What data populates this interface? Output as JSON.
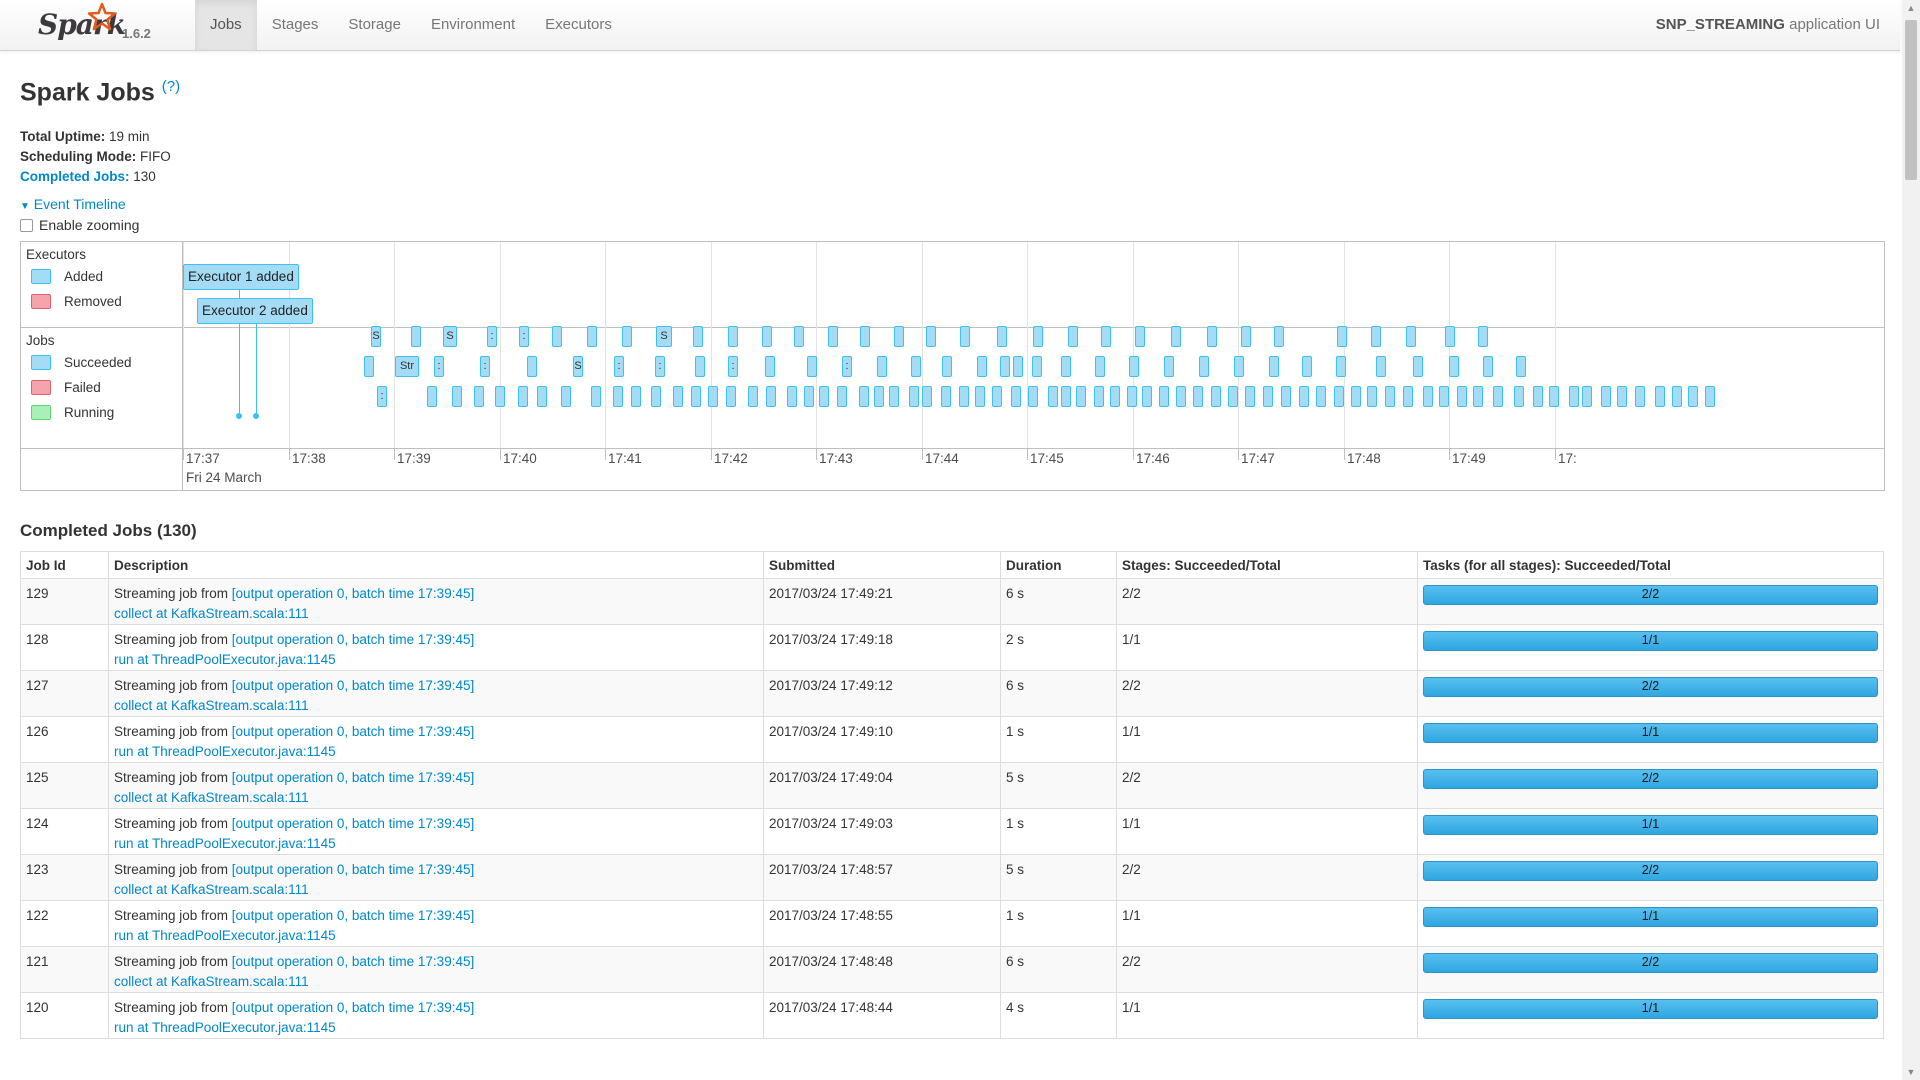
{
  "navbar": {
    "brand": "Spark",
    "version": "1.6.2",
    "tabs": [
      {
        "label": "Jobs",
        "active": true
      },
      {
        "label": "Stages",
        "active": false
      },
      {
        "label": "Storage",
        "active": false
      },
      {
        "label": "Environment",
        "active": false
      },
      {
        "label": "Executors",
        "active": false
      }
    ],
    "app_name": "SNP_STREAMING",
    "app_suffix": "application UI"
  },
  "page": {
    "title": "Spark Jobs",
    "help": "(?)",
    "uptime_label": "Total Uptime:",
    "uptime_value": "19 min",
    "mode_label": "Scheduling Mode:",
    "mode_value": "FIFO",
    "completed_label": "Completed Jobs:",
    "completed_value": "130",
    "timeline_toggle": "Event Timeline",
    "zoom_label": "Enable zooming"
  },
  "timeline": {
    "executors_title": "Executors",
    "legend_added": "Added",
    "legend_removed": "Removed",
    "jobs_title": "Jobs",
    "legend_succeeded": "Succeeded",
    "legend_failed": "Failed",
    "legend_running": "Running",
    "executor1": "Executor 1 added",
    "executor2": "Executor 2 added",
    "axis_labels": [
      "17:37",
      "17:38",
      "17:39",
      "17:40",
      "17:41",
      "17:42",
      "17:43",
      "17:44",
      "17:45",
      "17:46",
      "17:47",
      "17:48",
      "17:49",
      "17:"
    ],
    "date_label": "Fri 24 March"
  },
  "completed": {
    "title": "Completed Jobs (130)",
    "headers": [
      "Job Id",
      "Description",
      "Submitted",
      "Duration",
      "Stages: Succeeded/Total",
      "Tasks (for all stages): Succeeded/Total"
    ],
    "desc_prefix": "Streaming job from ",
    "desc_link": "[output operation 0, batch time 17:39:45]",
    "rows": [
      {
        "id": "129",
        "callsite": "collect at KafkaStream.scala:111",
        "submitted": "2017/03/24 17:49:21",
        "duration": "6 s",
        "stages": "2/2",
        "tasks": "2/2",
        "task_progress": 1.0
      },
      {
        "id": "128",
        "callsite": "run at ThreadPoolExecutor.java:1145",
        "submitted": "2017/03/24 17:49:18",
        "duration": "2 s",
        "stages": "1/1",
        "tasks": "1/1",
        "task_progress": 1.0
      },
      {
        "id": "127",
        "callsite": "collect at KafkaStream.scala:111",
        "submitted": "2017/03/24 17:49:12",
        "duration": "6 s",
        "stages": "2/2",
        "tasks": "2/2",
        "task_progress": 1.0
      },
      {
        "id": "126",
        "callsite": "run at ThreadPoolExecutor.java:1145",
        "submitted": "2017/03/24 17:49:10",
        "duration": "1 s",
        "stages": "1/1",
        "tasks": "1/1",
        "task_progress": 1.0
      },
      {
        "id": "125",
        "callsite": "collect at KafkaStream.scala:111",
        "submitted": "2017/03/24 17:49:04",
        "duration": "5 s",
        "stages": "2/2",
        "tasks": "2/2",
        "task_progress": 1.0
      },
      {
        "id": "124",
        "callsite": "run at ThreadPoolExecutor.java:1145",
        "submitted": "2017/03/24 17:49:03",
        "duration": "1 s",
        "stages": "1/1",
        "tasks": "1/1",
        "task_progress": 1.0
      },
      {
        "id": "123",
        "callsite": "collect at KafkaStream.scala:111",
        "submitted": "2017/03/24 17:48:57",
        "duration": "5 s",
        "stages": "2/2",
        "tasks": "2/2",
        "task_progress": 1.0
      },
      {
        "id": "122",
        "callsite": "run at ThreadPoolExecutor.java:1145",
        "submitted": "2017/03/24 17:48:55",
        "duration": "1 s",
        "stages": "1/1",
        "tasks": "1/1",
        "task_progress": 1.0
      },
      {
        "id": "121",
        "callsite": "collect at KafkaStream.scala:111",
        "submitted": "2017/03/24 17:48:48",
        "duration": "6 s",
        "stages": "2/2",
        "tasks": "2/2",
        "task_progress": 1.0
      },
      {
        "id": "120",
        "callsite": "run at ThreadPoolExecutor.java:1145",
        "submitted": "2017/03/24 17:48:44",
        "duration": "4 s",
        "stages": "1/1",
        "tasks": "1/1",
        "task_progress": 1.0
      }
    ]
  }
}
